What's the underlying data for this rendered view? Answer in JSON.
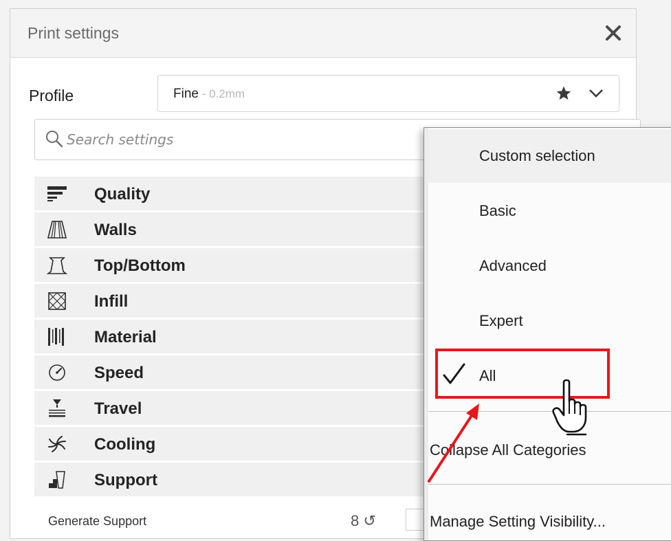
{
  "panel": {
    "title": "Print settings",
    "close_icon": "close-icon"
  },
  "profile": {
    "label": "Profile",
    "name": "Fine",
    "separator": " - ",
    "layer_height": "0.2mm",
    "favorite_icon": "star-icon",
    "dropdown_icon": "chevron-down-icon"
  },
  "search": {
    "placeholder": "Search settings",
    "icon": "search-icon"
  },
  "categories": [
    {
      "label": "Quality",
      "icon": "quality-icon"
    },
    {
      "label": "Walls",
      "icon": "walls-icon"
    },
    {
      "label": "Top/Bottom",
      "icon": "top-bottom-icon"
    },
    {
      "label": "Infill",
      "icon": "infill-icon"
    },
    {
      "label": "Material",
      "icon": "material-icon"
    },
    {
      "label": "Speed",
      "icon": "speed-icon"
    },
    {
      "label": "Travel",
      "icon": "travel-icon"
    },
    {
      "label": "Cooling",
      "icon": "cooling-icon"
    },
    {
      "label": "Support",
      "icon": "support-icon"
    }
  ],
  "partial_row": {
    "label": "Generate Support",
    "tools": "8 ↺"
  },
  "visibility_menu": {
    "items": [
      {
        "label": "Custom selection",
        "highlighted": true
      },
      {
        "label": "Basic"
      },
      {
        "label": "Advanced"
      },
      {
        "label": "Expert"
      },
      {
        "label": "All",
        "checked": true
      }
    ],
    "actions": [
      {
        "label": "Collapse All Categories"
      },
      {
        "label": "Manage Setting Visibility..."
      }
    ]
  },
  "annotation": {
    "highlight_color": "#e8171c",
    "cursor_icon": "hand-pointer-icon"
  }
}
